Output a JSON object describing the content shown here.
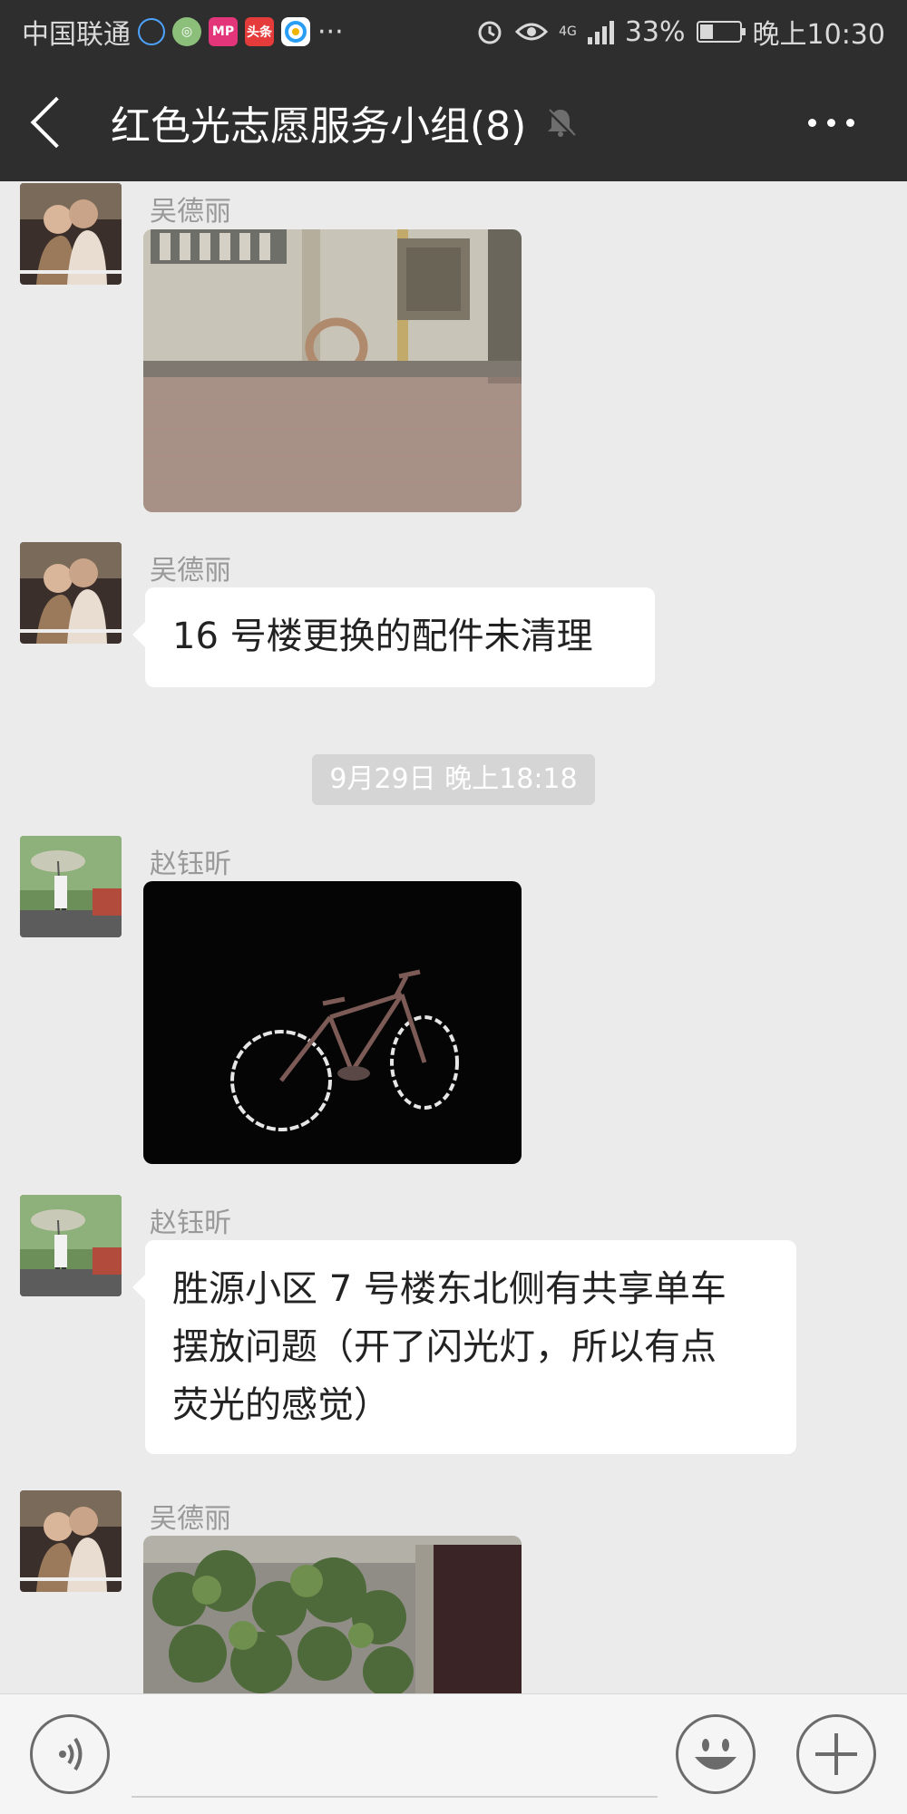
{
  "status_bar": {
    "carrier": "中国联通",
    "more_apps": "···",
    "network": "4G",
    "battery": "33%",
    "battery_level": 0.33,
    "time": "晚上10:30",
    "app_icons": [
      "hearing-aid-icon",
      "coin-icon",
      "mp-icon",
      "toutiao-icon",
      "browser-icon"
    ]
  },
  "header": {
    "title": "红色光志愿服务小组(8)",
    "back_icon": "chevron-left-icon",
    "mute_icon": "bell-muted-icon",
    "more_icon": "more-dots-icon"
  },
  "messages": [
    {
      "sender": "吴德丽",
      "type": "image",
      "image": "wall-with-tire-on-pavement"
    },
    {
      "sender": "吴德丽",
      "type": "text",
      "text": "16 号楼更换的配件未清理"
    },
    {
      "type": "timestamp",
      "text": "9月29日 晚上18:18"
    },
    {
      "sender": "赵钰昕",
      "type": "image",
      "image": "reflective-bicycle-at-night"
    },
    {
      "sender": "赵钰昕",
      "type": "text",
      "lines": [
        "胜源小区 7 号楼东北侧有共享单车",
        "摆放问题（开了闪光灯，所以有点",
        "荧光的感觉）"
      ]
    },
    {
      "sender": "吴德丽",
      "type": "image",
      "image": "green-plants-by-doorway"
    }
  ],
  "input_bar": {
    "voice_icon": "voice-icon",
    "emoji_icon": "emoji-icon",
    "add_icon": "plus-icon"
  },
  "colors": {
    "bar_dark": "#2e2e2e",
    "chat_background": "#ebebeb",
    "bubble": "#ffffff",
    "sender_name": "#999999"
  }
}
